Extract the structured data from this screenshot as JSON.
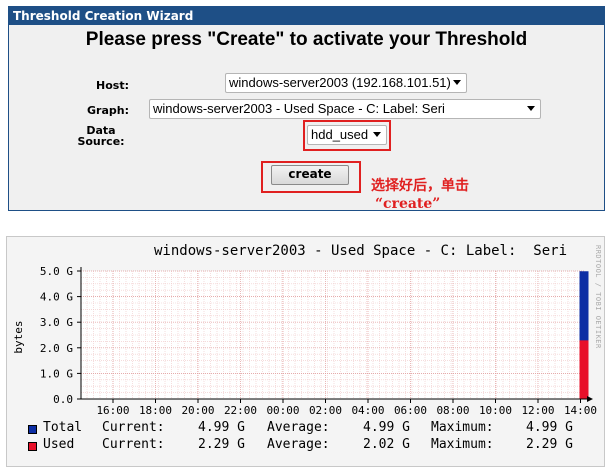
{
  "wizard": {
    "header": "Threshold Creation Wizard",
    "title": "Please press \"Create\" to activate your Threshold",
    "host_label": "Host:",
    "host_value": "windows-server2003 (192.168.101.51)",
    "graph_label": "Graph:",
    "graph_value": "windows-server2003 - Used Space - C: Label: Seri",
    "ds_label_line1": "Data",
    "ds_label_line2": "Source:",
    "ds_value": "hdd_used",
    "create_label": "create",
    "annotation_line1": "选择好后，单击",
    "annotation_line2": "“create”"
  },
  "graph": {
    "title": "windows-server2003 - Used Space - C: Label:  Seri",
    "watermark": "RRDTOOL / TOBI OETIKER",
    "ylabel": "bytes",
    "legend": [
      {
        "name": "Total",
        "color": "#0d2ea4",
        "current": "4.99 G",
        "average": "4.99 G",
        "maximum": "4.99 G"
      },
      {
        "name": "Used",
        "color": "#e8102a",
        "current": "2.29 G",
        "average": "2.02 G",
        "maximum": "2.29 G"
      }
    ],
    "current_label": "Current:",
    "average_label": "Average:",
    "maximum_label": "Maximum:"
  },
  "chart_data": {
    "type": "area",
    "title": "windows-server2003 - Used Space - C: Label:  Seri",
    "ylabel": "bytes",
    "ylim": [
      0,
      5.0
    ],
    "y_ticks": [
      "0.0",
      "1.0 G",
      "2.0 G",
      "3.0 G",
      "4.0 G",
      "5.0 G"
    ],
    "x_ticks": [
      "16:00",
      "18:00",
      "20:00",
      "22:00",
      "00:00",
      "02:00",
      "04:00",
      "06:00",
      "08:00",
      "10:00",
      "12:00",
      "14:00"
    ],
    "grid": true,
    "series": [
      {
        "name": "Total",
        "unit": "G",
        "x": [
          "14:00"
        ],
        "values": [
          4.99
        ]
      },
      {
        "name": "Used",
        "unit": "G",
        "x": [
          "14:00"
        ],
        "values": [
          2.29
        ]
      }
    ]
  }
}
